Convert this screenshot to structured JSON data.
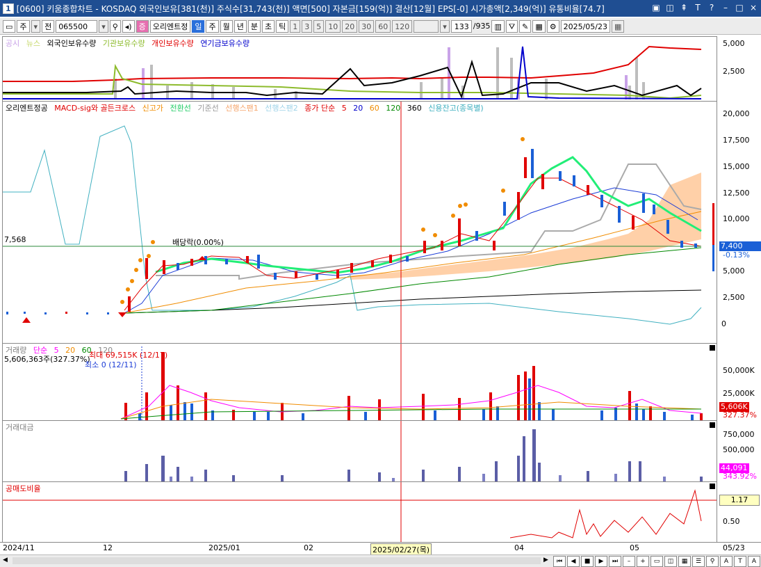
{
  "window": {
    "number": "1",
    "title": "[0600] 키움종합차트 - KOSDAQ 외국인보유[381(천)] 주식수[31,743(천)] 액면[500] 자본금[159(억)] 결산[12월] EPS[-0] 시가총액[2,349(억)] 유통비율[74.7]"
  },
  "toolbar": {
    "market": "주",
    "prev": "전",
    "code": "065500",
    "stock_name": "오리엔트정",
    "periods": [
      "일",
      "주",
      "월",
      "년",
      "분",
      "초",
      "틱"
    ],
    "active_period": "일",
    "intervals": [
      "1",
      "3",
      "5",
      "10",
      "20",
      "30",
      "60",
      "120"
    ],
    "count": "133",
    "total": "/935",
    "date": "2025/05/23"
  },
  "panes": {
    "investor": {
      "legend": [
        "공시",
        "뉴스",
        "외국인보유수량",
        "기관보유수량",
        "개인보유수량",
        "연기금보유수량"
      ],
      "legend_colors": [
        "#c9a3e8",
        "#c6d86a",
        "#000000",
        "#8dbb2c",
        "#e00000",
        "#0000cc"
      ],
      "y_ticks": [
        "5,000",
        "2,500"
      ]
    },
    "price": {
      "legend": [
        "오리엔트정공",
        "MACD-sig와 골든크로스",
        "신고가",
        "전환선",
        "기준선",
        "선행스팬1",
        "선행스팬2",
        "종가 단순",
        "5",
        "20",
        "60",
        "120",
        "360",
        "신용잔고(종목별)"
      ],
      "legend_colors": [
        "#000000",
        "#e00000",
        "#f08c00",
        "#22cc66",
        "#999999",
        "#f6a56b",
        "#c9e6f2",
        "#e00000",
        "#e00000",
        "#0000cc",
        "#f08c00",
        "#008800",
        "#000000",
        "#40b0c0"
      ],
      "y_ticks": [
        "20,000",
        "17,500",
        "15,000",
        "12,500",
        "10,000",
        "7,500",
        "5,000",
        "2,500",
        "0"
      ],
      "hline_label": "7,568",
      "dividend_label": "배당락(0.00%)",
      "current_price": "7,400",
      "change_pct": "-0.13%"
    },
    "volume": {
      "legend": [
        "거래량",
        "단순",
        "5",
        "20",
        "60",
        "120"
      ],
      "legend_colors": [
        "#808080",
        "#ff00ff",
        "#ff00ff",
        "#f08c00",
        "#008800",
        "#888888"
      ],
      "info_line": "5,606,363주(327.37%)",
      "max_label": "최대 69,515K (12/17)",
      "min_label": "최소 0 (12/11)",
      "y_ticks": [
        "50,000K",
        "25,000K"
      ],
      "current": "5,606K",
      "current_pct": "327.37%"
    },
    "amount": {
      "legend": [
        "거래대금"
      ],
      "y_ticks": [
        "750,000",
        "500,000"
      ],
      "current": "44,091",
      "current_pct": "343.92%"
    },
    "short": {
      "legend": [
        "공매도비율"
      ],
      "y_ticks": [
        "0.50"
      ],
      "current": "1.17"
    }
  },
  "xaxis": {
    "labels": [
      "2024/11",
      "12",
      "2025/01",
      "02",
      "2025/02/27(목)",
      "04",
      "05",
      "05/23"
    ]
  },
  "colors": {
    "up": "#e00000",
    "down": "#1a5fd6",
    "titlebar": "#1f4e92"
  }
}
